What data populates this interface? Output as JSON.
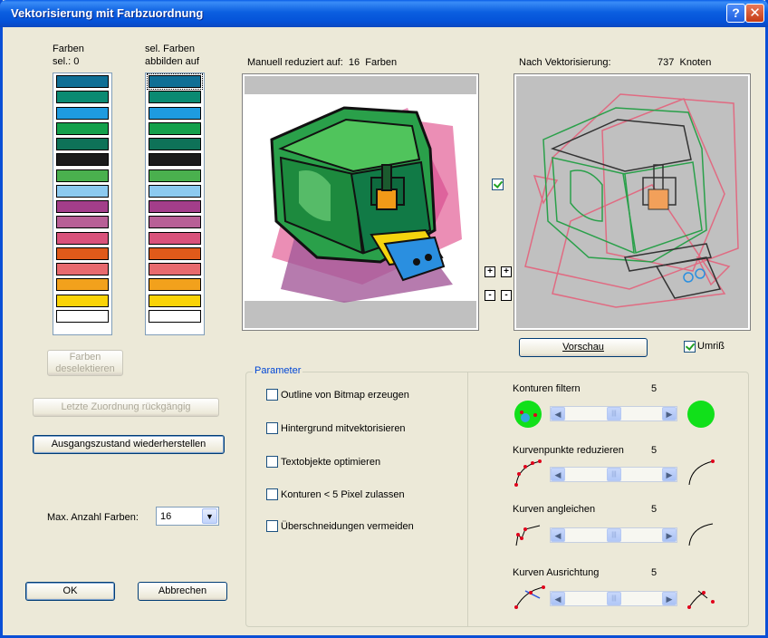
{
  "window": {
    "title": "Vektorisierung mit Farbzuordnung",
    "help_btn": "?",
    "close_btn": "✕"
  },
  "left": {
    "farben_header_1": "Farben",
    "farben_header_2": "sel.: 0",
    "mapped_header_1": "sel. Farben",
    "mapped_header_2": "abbilden auf",
    "colors": [
      "#0f6f95",
      "#0a8a72",
      "#1e9be0",
      "#13a04b",
      "#0e7258",
      "#1c1c1c",
      "#4ab04e",
      "#8ccaf0",
      "#a33e8a",
      "#b85f96",
      "#d9527b",
      "#e05a1a",
      "#e86a6e",
      "#f2a11c",
      "#fad307",
      "#ffffff"
    ],
    "deselect_line1": "Farben",
    "deselect_line2": "deselektieren",
    "undo_label": "Letzte Zuordnung rückgängig",
    "restore_label": "Ausgangszustand wiederherstellen",
    "max_colors_label": "Max. Anzahl Farben:",
    "max_colors_value": "16",
    "ok_label": "OK",
    "cancel_label": "Abbrechen"
  },
  "original": {
    "caption_prefix": "Manuell reduziert auf:",
    "count": "16",
    "unit": "Farben"
  },
  "vector": {
    "caption_prefix": "Nach Vektorisierung:",
    "count": "737",
    "unit": "Knoten"
  },
  "preview_label": "Vorschau",
  "outline_label": "Umriß",
  "outline_checked": true,
  "sync_checked": true,
  "zoom_buttons": [
    "+",
    "+",
    "-",
    "-"
  ],
  "parameter": {
    "legend": "Parameter",
    "options": [
      {
        "label": "Outline von Bitmap erzeugen",
        "checked": false
      },
      {
        "label": "Hintergrund mitvektorisieren",
        "checked": false
      },
      {
        "label": "Textobjekte optimieren",
        "checked": false
      },
      {
        "label": "Konturen < 5 Pixel zulassen",
        "checked": false
      },
      {
        "label": "Überschneidungen vermeiden",
        "checked": false
      }
    ]
  },
  "sliders": [
    {
      "label": "Konturen filtern",
      "value": "5"
    },
    {
      "label": "Kurvenpunkte reduzieren",
      "value": "5"
    },
    {
      "label": "Kurven angleichen",
      "value": "5"
    },
    {
      "label": "Kurven Ausrichtung",
      "value": "5"
    }
  ],
  "icons": {
    "left_arrow": "◀",
    "right_arrow": "▶",
    "thumb": "|||",
    "dropdown": "▼"
  }
}
